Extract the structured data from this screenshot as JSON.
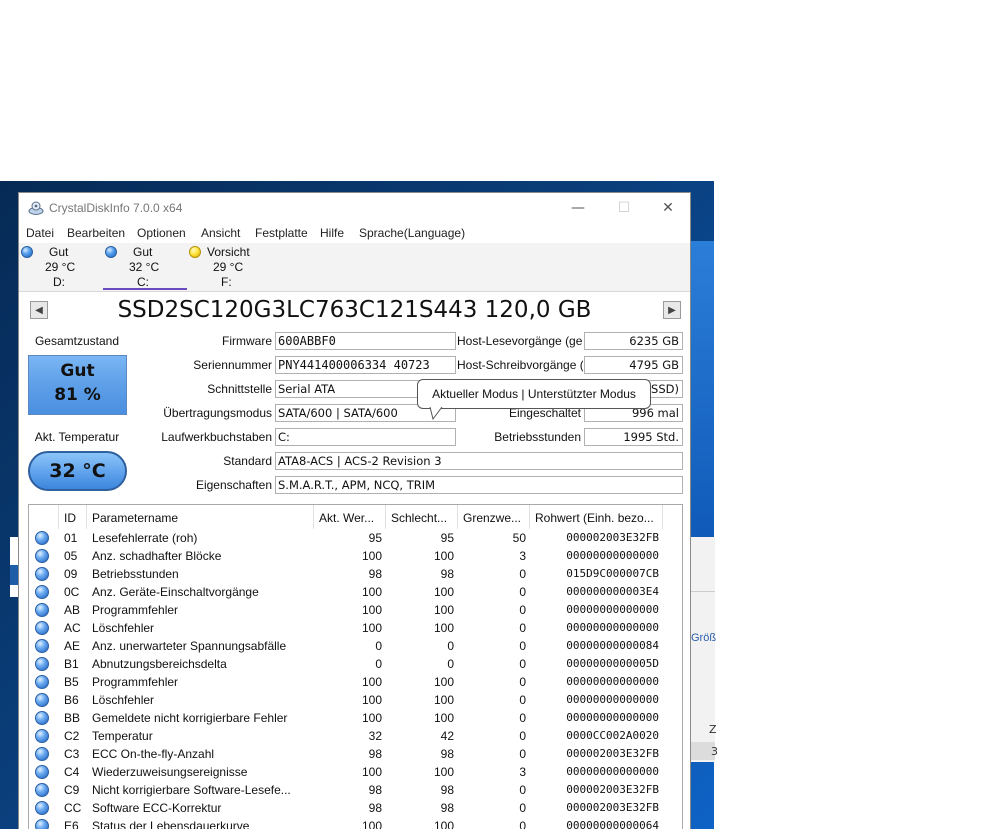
{
  "window": {
    "title": "CrystalDiskInfo 7.0.0 x64",
    "minimize_glyph": "—",
    "maximize_glyph": "☐",
    "close_glyph": "✕"
  },
  "menu": [
    "Datei",
    "Bearbeiten",
    "Optionen",
    "Ansicht",
    "Festplatte",
    "Hilfe",
    "Sprache(Language)"
  ],
  "drives": [
    {
      "status": "Gut",
      "temp": "29 °C",
      "letter": "D:",
      "color": "blue"
    },
    {
      "status": "Gut",
      "temp": "32 °C",
      "letter": "C:",
      "color": "blue"
    },
    {
      "status": "Vorsicht",
      "temp": "29 °C",
      "letter": "F:",
      "color": "yellow"
    }
  ],
  "model": "SSD2SC120G3LC763C121S443 120,0 GB",
  "health": {
    "label": "Gesamtzustand",
    "status": "Gut",
    "percent": "81 %"
  },
  "temperature": {
    "label": "Akt. Temperatur",
    "value": "32 °C"
  },
  "info": {
    "firmware_label": "Firmware",
    "firmware": "600ABBF0",
    "serial_label": "Seriennummer",
    "serial": "PNY441400006334 40723",
    "interface_label": "Schnittstelle",
    "interface": "Serial ATA",
    "transfer_label": "Übertragungsmodus",
    "transfer": "SATA/600 | SATA/600",
    "drive_letter_label": "Laufwerkbuchstaben",
    "drive_letter": "C:",
    "standard_label": "Standard",
    "standard": "ATA8-ACS | ACS-2 Revision 3",
    "features_label": "Eigenschaften",
    "features": "S.M.A.R.T., APM, NCQ, TRIM",
    "host_reads_label": "Host-Lesevorgänge (ge",
    "host_reads": "6235 GB",
    "host_writes_label": "Host-Schreibvorgänge (",
    "host_writes": "4795 GB",
    "rotation_value": "SSD)",
    "power_count_label": "Eingeschaltet",
    "power_count": "996 mal",
    "power_hours_label": "Betriebsstunden",
    "power_hours": "1995 Std."
  },
  "tooltip": "Aktueller Modus | Unterstützter Modus",
  "table": {
    "headers": [
      "ID",
      "Parametername",
      "Akt. Wer...",
      "Schlecht...",
      "Grenzwe...",
      "Rohwert (Einh. bezo..."
    ],
    "rows": [
      [
        "01",
        "Lesefehlerrate (roh)",
        "95",
        "95",
        "50",
        "000002003E32FB"
      ],
      [
        "05",
        "Anz. schadhafter Blöcke",
        "100",
        "100",
        "3",
        "00000000000000"
      ],
      [
        "09",
        "Betriebsstunden",
        "98",
        "98",
        "0",
        "015D9C000007CB"
      ],
      [
        "0C",
        "Anz. Geräte-Einschaltvorgänge",
        "100",
        "100",
        "0",
        "000000000003E4"
      ],
      [
        "AB",
        "Programmfehler",
        "100",
        "100",
        "0",
        "00000000000000"
      ],
      [
        "AC",
        "Löschfehler",
        "100",
        "100",
        "0",
        "00000000000000"
      ],
      [
        "AE",
        "Anz. unerwarteter Spannungsabfälle",
        "0",
        "0",
        "0",
        "00000000000084"
      ],
      [
        "B1",
        "Abnutzungsbereichsdelta",
        "0",
        "0",
        "0",
        "0000000000005D"
      ],
      [
        "B5",
        "Programmfehler",
        "100",
        "100",
        "0",
        "00000000000000"
      ],
      [
        "B6",
        "Löschfehler",
        "100",
        "100",
        "0",
        "00000000000000"
      ],
      [
        "BB",
        "Gemeldete nicht korrigierbare Fehler",
        "100",
        "100",
        "0",
        "00000000000000"
      ],
      [
        "C2",
        "Temperatur",
        "32",
        "42",
        "0",
        "0000CC002A0020"
      ],
      [
        "C3",
        "ECC On-the-fly-Anzahl",
        "98",
        "98",
        "0",
        "000002003E32FB"
      ],
      [
        "C4",
        "Wiederzuweisungsereignisse",
        "100",
        "100",
        "3",
        "00000000000000"
      ],
      [
        "C9",
        "Nicht korrigierbare Software-Lesefe...",
        "98",
        "98",
        "0",
        "000002003E32FB"
      ],
      [
        "CC",
        "Software ECC-Korrektur",
        "98",
        "98",
        "0",
        "000002003E32FB"
      ],
      [
        "E6",
        "Status der Lebensdauerkurve",
        "100",
        "100",
        "0",
        "00000000000064"
      ]
    ]
  },
  "background": {
    "label_a": "Größ",
    "label_b": "Z",
    "label_c": "3"
  }
}
